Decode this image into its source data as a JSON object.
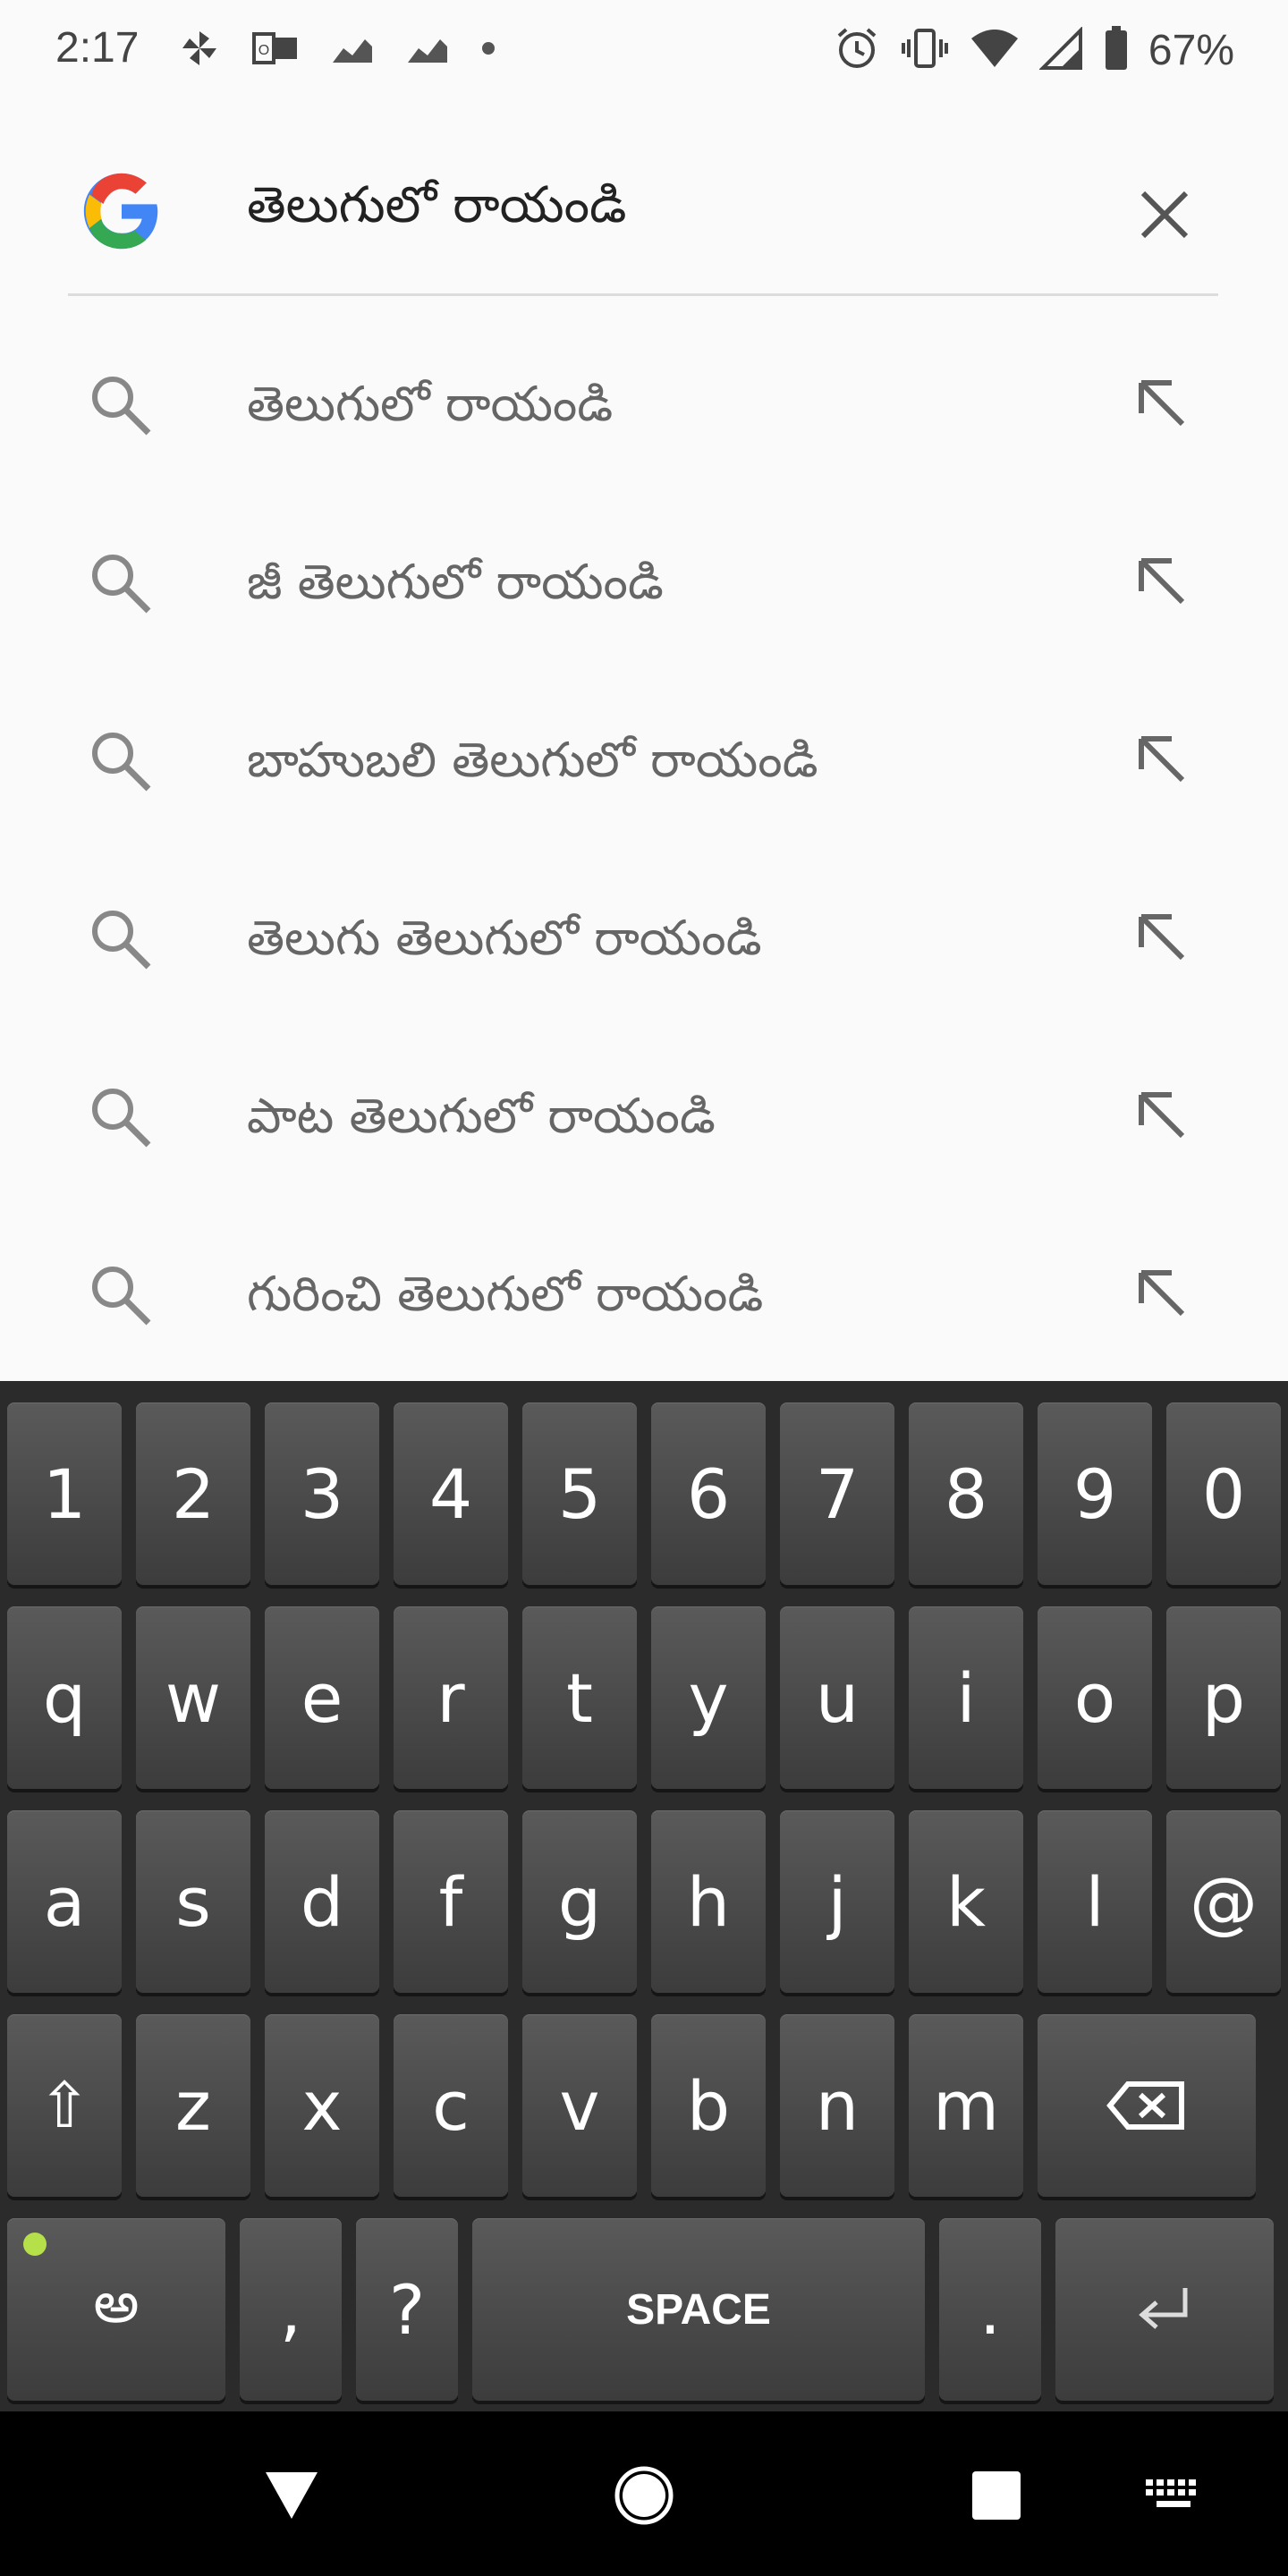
{
  "status_bar": {
    "time": "2:17",
    "battery": "67%",
    "left_icons": [
      "pinwheel-icon",
      "outlook-icon",
      "stocks-icon",
      "stocks-icon",
      "dot-icon"
    ],
    "right_icons": [
      "alarm-icon",
      "vibrate-icon",
      "wifi-icon",
      "signal-icon",
      "battery-icon"
    ]
  },
  "search": {
    "query": "తెలుగులో రాయండి",
    "logo": "google-logo",
    "clear_icon": "close-icon"
  },
  "suggestions": [
    {
      "text": "తెలుగులో రాయండి"
    },
    {
      "text": "జీ తెలుగులో రాయండి"
    },
    {
      "text": "బాహుబలి తెలుగులో రాయండి"
    },
    {
      "text": "తెలుగు తెలుగులో రాయండి"
    },
    {
      "text": "పాట తెలుగులో రాయండి"
    },
    {
      "text": "గురించి తెలుగులో రాయండి"
    }
  ],
  "keyboard": {
    "row1": [
      "1",
      "2",
      "3",
      "4",
      "5",
      "6",
      "7",
      "8",
      "9",
      "0"
    ],
    "row2": [
      "q",
      "w",
      "e",
      "r",
      "t",
      "y",
      "u",
      "i",
      "o",
      "p"
    ],
    "row3": [
      "a",
      "s",
      "d",
      "f",
      "g",
      "h",
      "j",
      "k",
      "l",
      "@"
    ],
    "row4": [
      "z",
      "x",
      "c",
      "v",
      "b",
      "n",
      "m"
    ],
    "shift": "⇧",
    "lang": "అ",
    "comma": ",",
    "question": "?",
    "space": "SPACE",
    "period": ".",
    "enter": "⏎",
    "lang_indicator_color": "#b6e04a"
  },
  "nav": {
    "back": "back-icon",
    "home": "home-icon",
    "recents": "recents-icon",
    "keyboard": "keyboard-icon"
  },
  "colors": {
    "background": "#fafafa",
    "keyboard_bg": "#2b2b2b",
    "text_primary": "#222222",
    "text_suggestion": "#666666"
  }
}
